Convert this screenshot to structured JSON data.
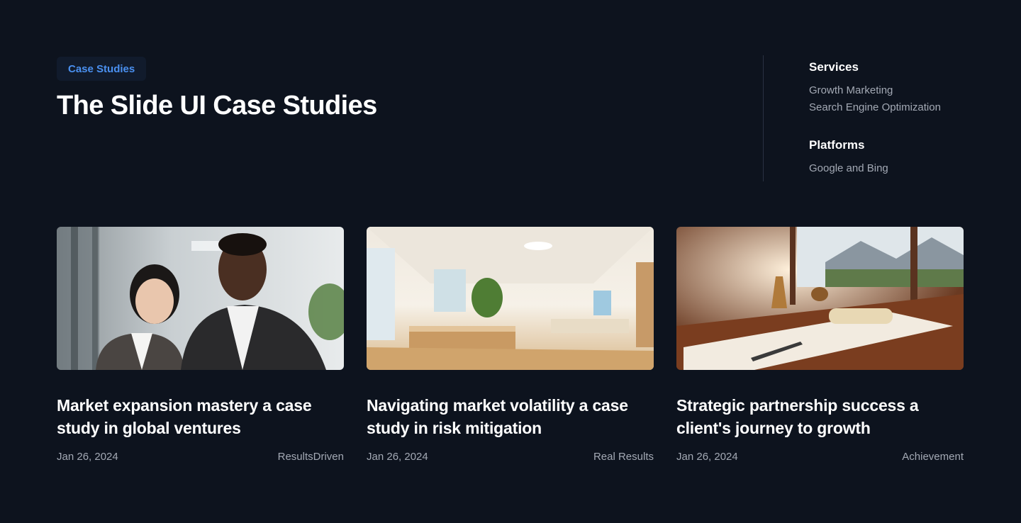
{
  "header": {
    "badge": "Case Studies",
    "title": "The Slide UI Case Studies"
  },
  "meta": {
    "services": {
      "heading": "Services",
      "items": [
        "Growth Marketing",
        "Search Engine Optimization"
      ]
    },
    "platforms": {
      "heading": "Platforms",
      "items": [
        "Google and Bing"
      ]
    }
  },
  "cards": [
    {
      "title": "Market expansion mastery a case study in global ventures",
      "date": "Jan 26, 2024",
      "tag": "ResultsDriven",
      "image": "business-people-photo"
    },
    {
      "title": "Navigating market volatility a case study in risk mitigation",
      "date": "Jan 26, 2024",
      "tag": "Real Results",
      "image": "office-interior-photo"
    },
    {
      "title": "Strategic partnership success a client's journey to growth",
      "date": "Jan 26, 2024",
      "tag": "Achievement",
      "image": "desk-document-photo"
    }
  ],
  "colors": {
    "background": "#0d131e",
    "accent": "#4a90f0",
    "muted_text": "#a3a9b4"
  }
}
